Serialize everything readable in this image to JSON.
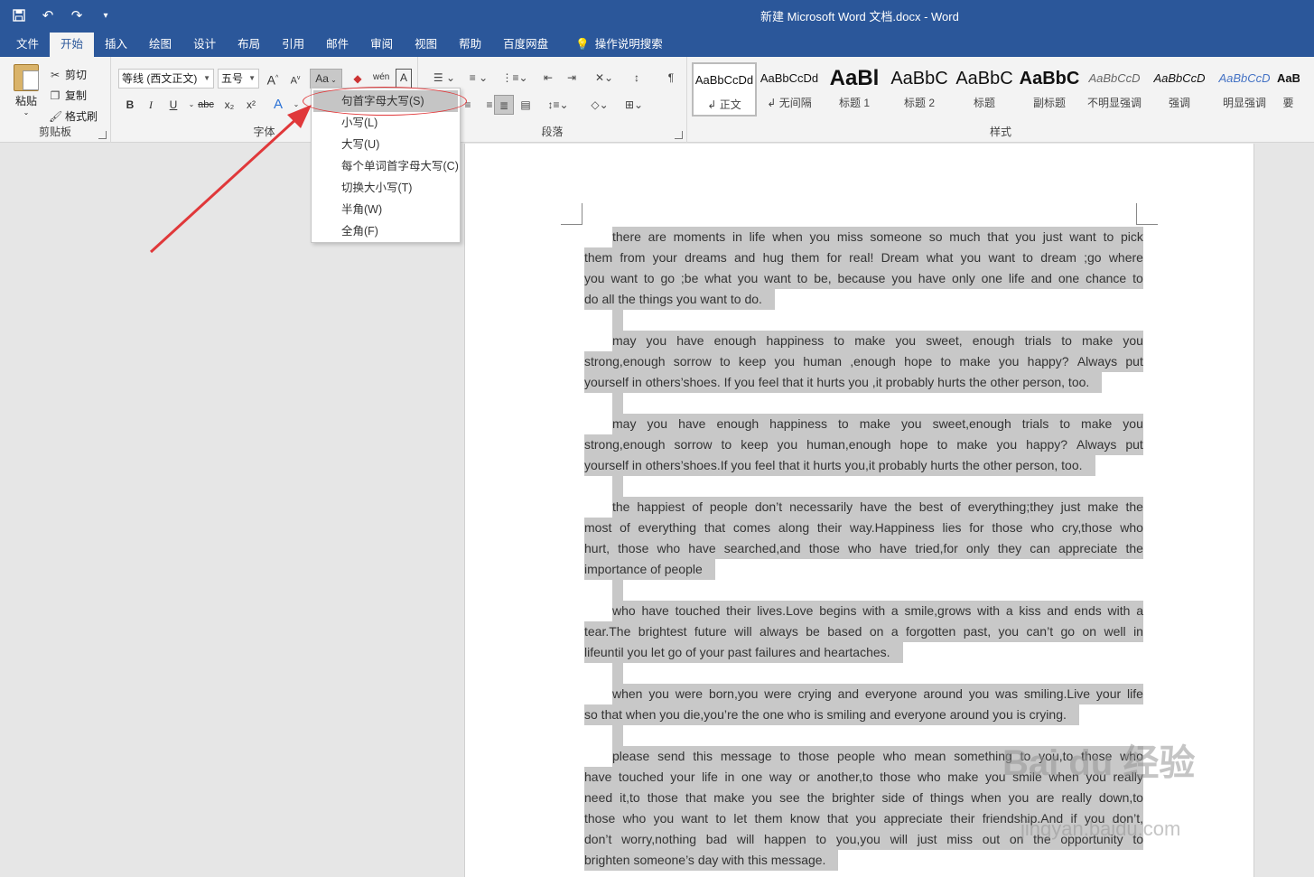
{
  "titlebar": {
    "title": "新建 Microsoft Word 文档.docx  -  Word"
  },
  "tabs": [
    {
      "label": "文件"
    },
    {
      "label": "开始"
    },
    {
      "label": "插入"
    },
    {
      "label": "绘图"
    },
    {
      "label": "设计"
    },
    {
      "label": "布局"
    },
    {
      "label": "引用"
    },
    {
      "label": "邮件"
    },
    {
      "label": "审阅"
    },
    {
      "label": "视图"
    },
    {
      "label": "帮助"
    },
    {
      "label": "百度网盘"
    },
    {
      "label": "操作说明搜索"
    }
  ],
  "clipboard": {
    "paste": "粘贴",
    "cut": "剪切",
    "copy": "复制",
    "format_painter": "格式刷",
    "label": "剪贴板"
  },
  "font": {
    "name": "等线 (西文正文)",
    "size": "五号",
    "grow": "A",
    "shrink": "A",
    "change_case": "Aa",
    "bold": "B",
    "italic": "I",
    "underline": "U",
    "strike": "abc",
    "sub": "x₂",
    "sup": "x²",
    "phonetic": "wén",
    "label": "字体"
  },
  "paragraph": {
    "label": "段落"
  },
  "styles": {
    "label": "样式",
    "items": [
      {
        "preview": "AaBbCcDd",
        "name": "正文"
      },
      {
        "preview": "AaBbCcDd",
        "name": "无间隔"
      },
      {
        "preview": "AaBl",
        "name": "标题 1"
      },
      {
        "preview": "AaBbC",
        "name": "标题 2"
      },
      {
        "preview": "AaBbC",
        "name": "标题"
      },
      {
        "preview": "AaBbC",
        "name": "副标题"
      },
      {
        "preview": "AaBbCcD",
        "name": "不明显强调"
      },
      {
        "preview": "AaBbCcD",
        "name": "强调"
      },
      {
        "preview": "AaBbCcD",
        "name": "明显强调"
      },
      {
        "preview": "AaBb",
        "name": "要"
      }
    ]
  },
  "case_menu": {
    "items": [
      "句首字母大写(S)",
      "小写(L)",
      "大写(U)",
      "每个单词首字母大写(C)",
      "切换大小写(T)",
      "半角(W)",
      "全角(F)"
    ]
  },
  "document": {
    "paragraphs": [
      [
        "there are moments in life when you miss someone so much that you just want to pick",
        "them from your dreams and hug them for real! Dream what you want to dream ;go where",
        "you want to go ;be what you want to be, because you have only one life and one chance to",
        "do all the things you want to do."
      ],
      [
        "may you have enough happiness to make you sweet, enough trials to make you",
        "strong,enough sorrow to keep you human ,enough hope to make you happy? Always put",
        "yourself in others’shoes. If you feel that it hurts you ,it probably hurts the other person, too."
      ],
      [
        "may you have enough happiness to make you sweet,enough trials to make you",
        "strong,enough sorrow to keep you human,enough hope to make you happy? Always put",
        "yourself in others’shoes.If you feel that it hurts you,it probably hurts the other person, too."
      ],
      [
        "the happiest of people don’t necessarily have the best of everything;they just make the",
        "most of everything that comes along their way.Happiness lies for those who cry,those who",
        "hurt, those who have searched,and those who have tried,for only they can appreciate the",
        "importance of people"
      ],
      [
        "who have touched their lives.Love begins with a smile,grows with a kiss and ends with a",
        "tear.The brightest future will always be based on a forgotten past, you can’t go on well in",
        "lifeuntil you let go of your past failures and heartaches."
      ],
      [
        "when you were born,you were crying and everyone around you was smiling.Live your life",
        "so that when you die,you’re the one who is smiling and everyone around you is crying."
      ],
      [
        "please send this message to those people who mean something to you,to those who",
        "have touched your life in one way or another,to those who make you smile when you really",
        "need it,to those that make you see the brighter side of things when you are really down,to",
        "those who you want to let them know that you appreciate their friendship.And if you don’t,",
        "don’t worry,nothing bad will happen to you,you will just miss out on the opportunity to",
        "brighten someone’s day with this message."
      ]
    ]
  },
  "watermark": {
    "brand": "Bai du 经验",
    "url": "jingyan.baidu.com"
  },
  "colors": {
    "ribbon_blue": "#2b579a",
    "highlight": "#c8c8c8",
    "annotation_red": "#e0383a"
  }
}
